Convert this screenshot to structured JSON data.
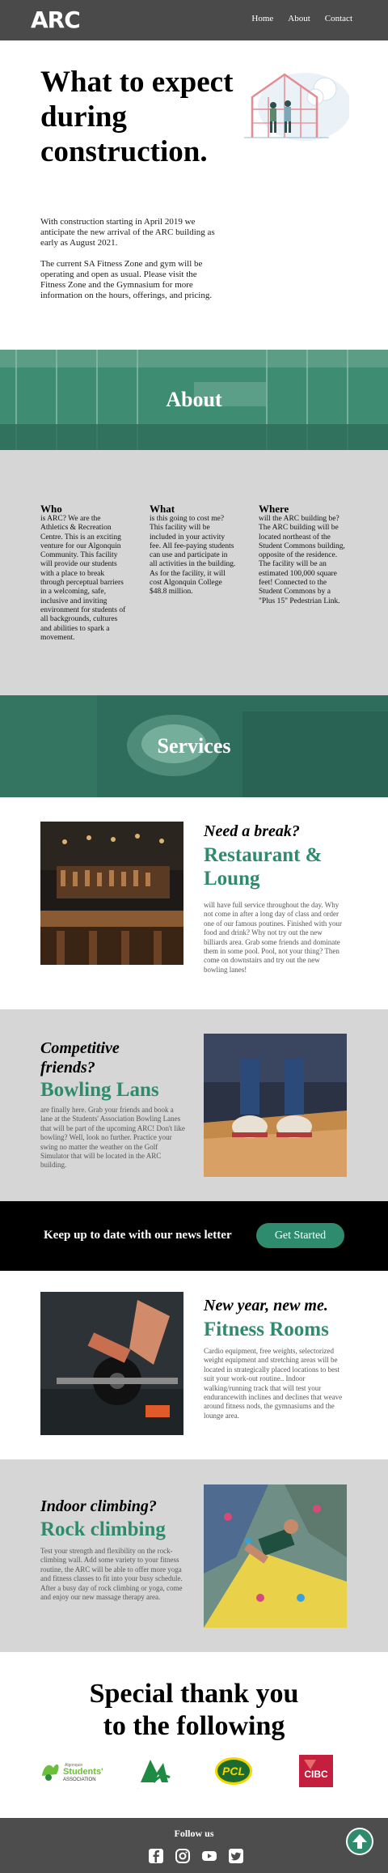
{
  "header": {
    "logo": "ARC",
    "nav": [
      "Home",
      "About",
      "Contact"
    ]
  },
  "hero": {
    "title": "What to expect during construction.",
    "para1": "With construction starting in April 2019 we anticipate the new arrival of the ARC building as early as August 2021.",
    "para2": "The current SA Fitness Zone and gym will be operating and open as usual. Please visit the Fitness Zone and the Gymnasium for more information on the hours, offerings, and pricing."
  },
  "about": {
    "banner": "About",
    "who": {
      "title": "Who",
      "text": "is ARC? We are the Athletics & Recreation Centre. This is an exciting venture for our Algonquin Community. This facility will provide our students with a place to break through perceptual barriers in a welcoming, safe, inclusive and inviting environment for students of all backgrounds, cultures and abilities to spark a movement."
    },
    "what": {
      "title": "What",
      "text": "is this going to cost me? This facility will be included in your activity fee. All fee-paying students can use and participate in all activities in the building. As for the facility, it will cost Algonquin College $48.8 million."
    },
    "where": {
      "title": "Where",
      "text": "will the ARC building be? The ARC building will be located northeast of the Student Commons building, opposite of the residence. The facility will be an estimated 100,000 square feet! Connected to the Student Commons by a \"Plus 15\" Pedestrian Link."
    }
  },
  "services": {
    "banner": "Services",
    "restaurant": {
      "kicker": "Need a break?",
      "title": "Restaurant & Loung",
      "text": "will have full service throughout the day. Why not come in after a long day of class and order one of our famous poutines. Finished with your food and drink? Why not try out the new billiards area. Grab some friends and dominate them in some pool. Pool, not your thing? Then come on downstairs and try out the new bowling lanes!"
    },
    "bowling": {
      "kicker": "Competitive friends?",
      "title": "Bowling Lans",
      "text": "are finally here. Grab your friends and book a lane at the Students' Association Bowling Lanes that will be part of the upcoming ARC! Don't like bowling? Well, look no further. Practice your swing no matter the weather on the Golf Simulator that will be located in the ARC building."
    },
    "fitness": {
      "kicker": "New year, new me.",
      "title": "Fitness Rooms",
      "text": "Cardio equipment, free weights, selectorized weight equipment and stretching areas will be located in strategically placed locations to best suit your work-out routine.. Indoor walking/running track that will test your endurancewith inclines and declines that weave around fitness nods, the gymnasiums and the lounge area."
    },
    "climbing": {
      "kicker": "Indoor climbing?",
      "title": "Rock climbing",
      "text": "Test your strength and flexibility on the rock-climbing wall. Add some variety to your fitness routine, the ARC will be able to offer more yoga and fitness classes to fit into your busy schedule. After a busy day of rock climbing or yoga, come and enjoy our new massage therapy area."
    }
  },
  "newsletter": {
    "text": "Keep up to date with our news letter",
    "button": "Get Started"
  },
  "thanks": {
    "line1": "Special thank you",
    "line2": "to the following",
    "sponsor1_small": "Algonquin",
    "sponsor1_big": "Students'",
    "sponsor1_sub": "ASSOCIATION",
    "sponsor2": "AC",
    "sponsor3": "PCL",
    "sponsor4": "CIBC"
  },
  "footer": {
    "follow": "Follow us",
    "icons": [
      "facebook-icon",
      "instagram-icon",
      "youtube-icon",
      "twitter-icon"
    ]
  },
  "colors": {
    "accent": "#2e8b6e",
    "header": "#4a4a4a",
    "section_grey": "#d6d6d6"
  }
}
